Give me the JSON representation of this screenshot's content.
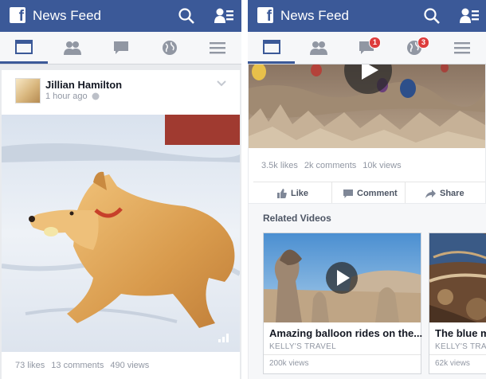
{
  "left": {
    "header_title": "News Feed",
    "post": {
      "author": "Jillian Hamilton",
      "time": "1 hour ago",
      "likes": "73 likes",
      "comments": "13 comments",
      "views": "490 views"
    }
  },
  "right": {
    "header_title": "News Feed",
    "badges": {
      "messages": "1",
      "notifications": "3"
    },
    "post": {
      "likes": "3.5k likes",
      "comments": "2k comments",
      "views": "10k views",
      "like_label": "Like",
      "comment_label": "Comment",
      "share_label": "Share"
    },
    "related_heading": "Related Videos",
    "videos": [
      {
        "title": "Amazing balloon rides on the...",
        "source": "KELLY'S TRAVEL",
        "views": "200k views"
      },
      {
        "title": "The blue mo",
        "source": "KELLY'S TRAV",
        "views": "62k views"
      }
    ]
  },
  "colors": {
    "brand": "#3b5998",
    "badge": "#dd3c3c"
  }
}
